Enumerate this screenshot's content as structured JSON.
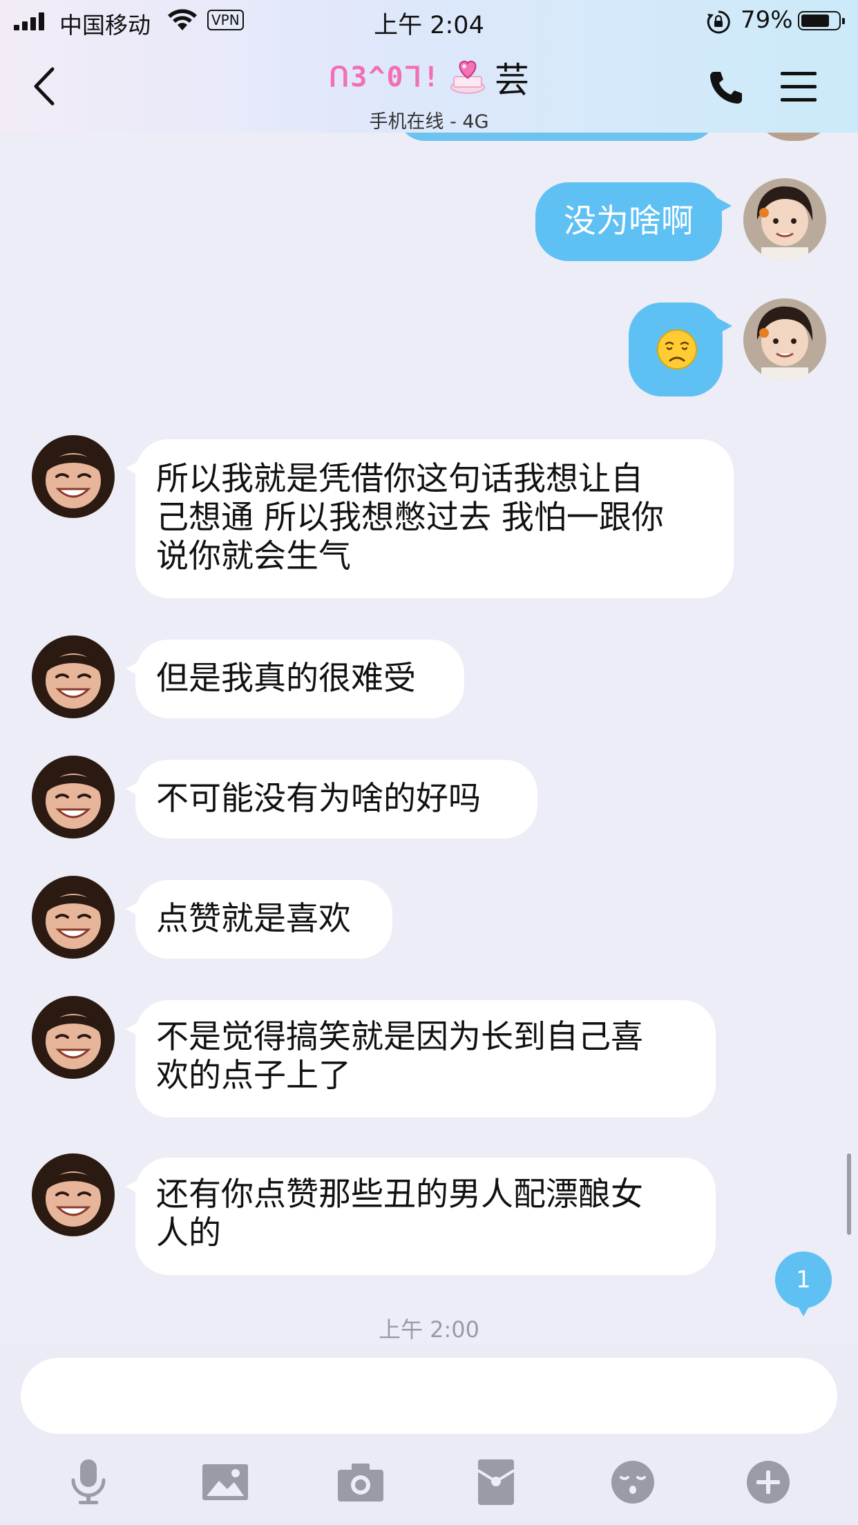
{
  "status_bar": {
    "carrier": "中国移动",
    "vpn": "VPN",
    "time": "上午 2:04",
    "battery_pct": "79%",
    "battery_level": 0.79
  },
  "header": {
    "title_deco": "ᑎ3^0ᒣ!",
    "title_name": "芸",
    "subtitle": "手机在线 - 4G",
    "icons": [
      "back-chevron-icon",
      "phone-icon",
      "menu-icon"
    ]
  },
  "messages": [
    {
      "side": "out",
      "text": "没为啥啊"
    },
    {
      "side": "out",
      "emoji": "disappointed-face-emoji"
    },
    {
      "side": "in",
      "lines": [
        "所以我就是凭借你这句话我想让自",
        "己想通 所以我想憋过去 我怕一跟你",
        "说你就会生气"
      ]
    },
    {
      "side": "in",
      "text": "但是我真的很难受"
    },
    {
      "side": "in",
      "text": "不可能没有为啥的好吗"
    },
    {
      "side": "in",
      "text": "点赞就是喜欢"
    },
    {
      "side": "in",
      "lines": [
        "不是觉得搞笑就是因为长到自己喜",
        "欢的点子上了"
      ]
    },
    {
      "side": "in",
      "lines": [
        "还有你点赞那些丑的男人配漂酿女",
        "人的"
      ]
    }
  ],
  "unread_count": "1",
  "timestamp": "上午 2:00",
  "input": {
    "value": "",
    "placeholder": ""
  },
  "toolbar": [
    "microphone-icon",
    "image-icon",
    "camera-icon",
    "red-packet-icon",
    "emoji-icon",
    "plus-icon"
  ],
  "colors": {
    "outgoing_bubble": "#5ec0f3",
    "incoming_bubble": "#ffffff",
    "background": "#ecedf6",
    "title_deco": "#f26fb6",
    "toolbar_icon": "#9a9ba6"
  }
}
